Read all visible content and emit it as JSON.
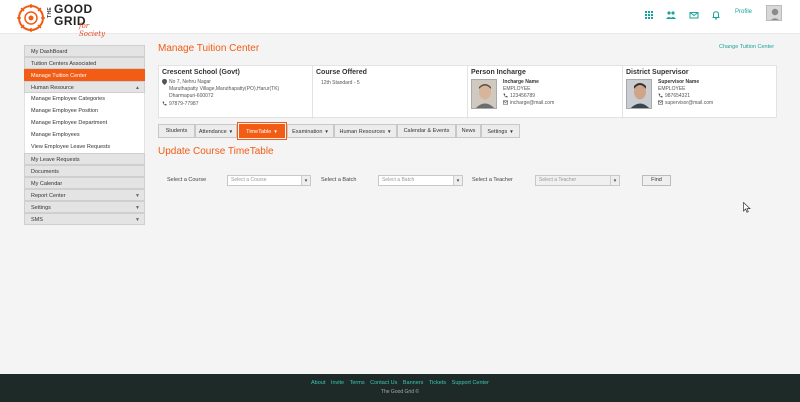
{
  "brand": {
    "the": "THE",
    "good": "GOOD",
    "grid": "GRID",
    "tagline": "for Society",
    "accent_color": "#f25c14",
    "link_color": "#1aa39a"
  },
  "header": {
    "icons": [
      "grid-icon",
      "users-icon",
      "mail-icon",
      "bell-icon"
    ],
    "profile_label": "Profile"
  },
  "sidebar": {
    "items": [
      {
        "label": "My DashBoard",
        "kind": "head"
      },
      {
        "label": "Tuition Centers Associated",
        "kind": "head"
      },
      {
        "label": "Manage Tuition Center",
        "kind": "active"
      },
      {
        "label": "Human Resource",
        "kind": "head",
        "arrow": "▲"
      },
      {
        "label": "Manage Employee Categories",
        "kind": "sub"
      },
      {
        "label": "Manage Employee Position",
        "kind": "sub"
      },
      {
        "label": "Manage Employee Department",
        "kind": "sub"
      },
      {
        "label": "Manage Employees",
        "kind": "sub"
      },
      {
        "label": "View Employee Leave Requests",
        "kind": "sub"
      },
      {
        "label": "My Leave Requests",
        "kind": "head"
      },
      {
        "label": "Documents",
        "kind": "head"
      },
      {
        "label": "My Calendar",
        "kind": "head"
      },
      {
        "label": "Report Center",
        "kind": "head",
        "arrow": "▼"
      },
      {
        "label": "Settings",
        "kind": "head",
        "arrow": "▼"
      },
      {
        "label": "SMS",
        "kind": "head",
        "arrow": "▼"
      }
    ]
  },
  "main": {
    "title": "Manage Tuition Center",
    "change_link": "Change Tuition Center",
    "school": {
      "name": "Crescent School (Govt)",
      "address1": "No 7, Nehru Nagar",
      "address2": "Maruthapatty Village,Maruthapatty(PO),Harur(TK)",
      "address3": "Dharmapuri-600072",
      "phone": "97879-77987"
    },
    "course": {
      "heading": "Course Offered",
      "value": "12th Standard - 5"
    },
    "incharge": {
      "heading": "Person Incharge",
      "name": "Incharge Name",
      "role": "EMPLOYEE",
      "phone": "123456789",
      "email": "incharge@mail.com"
    },
    "supervisor": {
      "heading": "District Supervisor",
      "name": "Supervisor Name",
      "role": "EMPLOYEE",
      "phone": "987654321",
      "email": "supervisor@mail.com"
    },
    "tabs": [
      {
        "label": "Students",
        "caret": ""
      },
      {
        "label": "Attendance",
        "caret": "▼"
      },
      {
        "label": "TimeTable",
        "caret": "▼"
      },
      {
        "label": "Examination",
        "caret": "▼"
      },
      {
        "label": "Human Resources",
        "caret": "▼"
      },
      {
        "label": "Calendar & Events",
        "caret": ""
      },
      {
        "label": "News",
        "caret": ""
      },
      {
        "label": "Settings",
        "caret": "▼"
      }
    ],
    "sub_title": "Update Course TimeTable",
    "filters": {
      "course_label": "Select a Course",
      "course_value": "Select a Course",
      "batch_label": "Select a Batch",
      "batch_value": "Select a Batch",
      "teacher_label": "Select a Teacher",
      "teacher_value": "Select a Teacher",
      "find_label": "Find"
    }
  },
  "footer": {
    "links": [
      "About",
      "Invite",
      "Terms",
      "Contact Us",
      "Banners",
      "Tickets",
      "Support Center"
    ],
    "copyright": "The Good Grid ©"
  }
}
